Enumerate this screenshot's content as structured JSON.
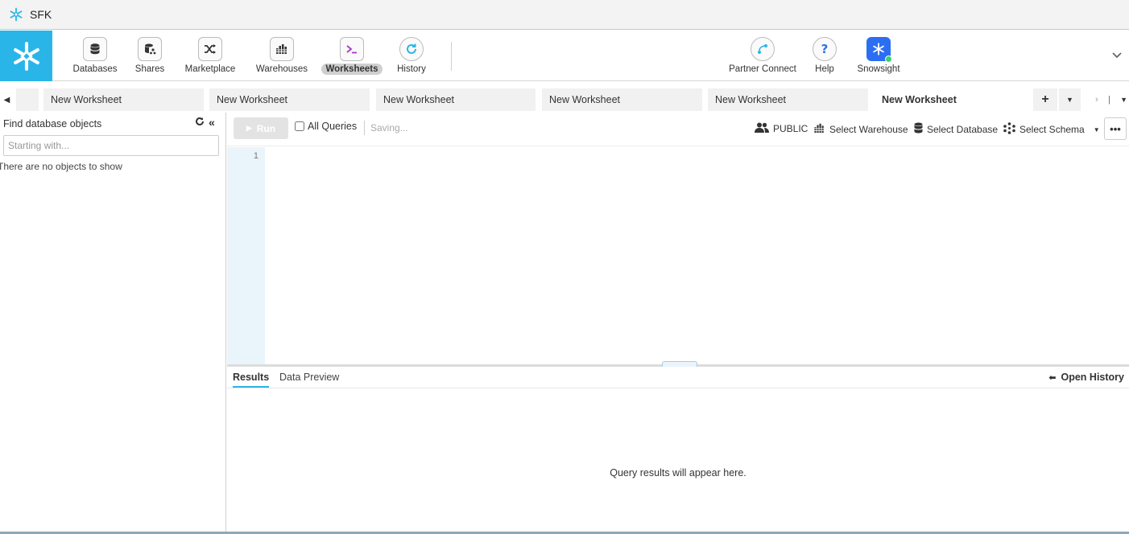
{
  "window": {
    "title": "SFK"
  },
  "nav": {
    "items": [
      {
        "label": "Databases",
        "icon": "database-icon"
      },
      {
        "label": "Shares",
        "icon": "share-icon"
      },
      {
        "label": "Marketplace",
        "icon": "shuffle-icon"
      },
      {
        "label": "Warehouses",
        "icon": "warehouse-icon"
      },
      {
        "label": "Worksheets",
        "icon": "terminal-icon",
        "active": true
      },
      {
        "label": "History",
        "icon": "history-icon"
      }
    ],
    "right_items": [
      {
        "label": "Partner Connect",
        "icon": "partner-connect-icon"
      },
      {
        "label": "Help",
        "icon": "help-icon"
      },
      {
        "label": "Snowsight",
        "icon": "snowsight-icon"
      }
    ]
  },
  "tabs": {
    "items": [
      {
        "label": "New Worksheet"
      },
      {
        "label": "New Worksheet"
      },
      {
        "label": "New Worksheet"
      },
      {
        "label": "New Worksheet"
      },
      {
        "label": "New Worksheet"
      },
      {
        "label": "New Worksheet",
        "active": true
      }
    ],
    "add_label": "+"
  },
  "left_panel": {
    "heading": "Find database objects",
    "search_placeholder": "Starting with...",
    "empty_text": "There are no objects to show"
  },
  "toolbar": {
    "run_label": "Run",
    "all_queries_label": "All Queries",
    "status": "Saving...",
    "role": "PUBLIC",
    "warehouse": "Select Warehouse",
    "database": "Select Database",
    "schema": "Select Schema"
  },
  "editor": {
    "line_number": "1"
  },
  "results": {
    "tabs": [
      {
        "label": "Results",
        "active": true
      },
      {
        "label": "Data Preview"
      }
    ],
    "open_history_label": "Open History",
    "empty_text": "Query results will appear here."
  },
  "colors": {
    "brand": "#29b5e8",
    "snowsight": "#2c6ef2",
    "gutter": "#e9f4fb"
  }
}
